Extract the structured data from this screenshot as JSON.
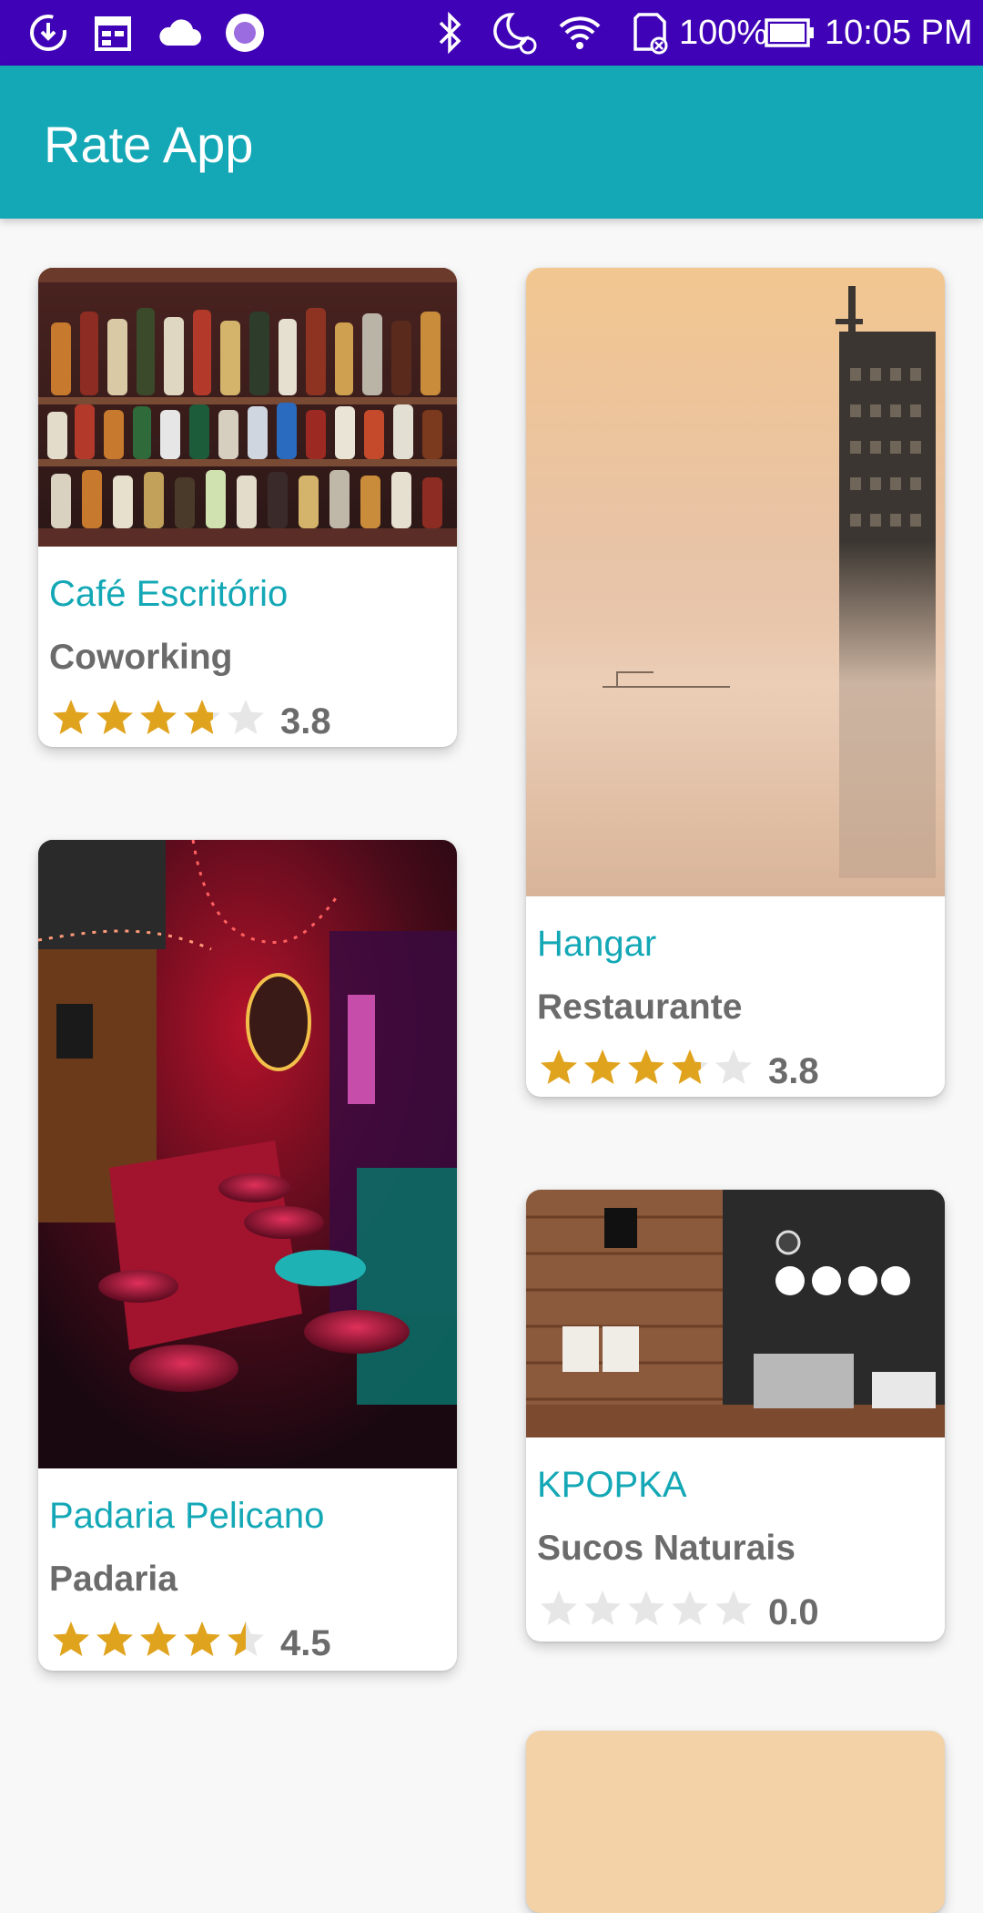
{
  "status_bar": {
    "battery": "100%",
    "time": "10:05 PM",
    "icons": [
      "download-icon",
      "calendar-icon",
      "cloud-icon",
      "circle-app-icon",
      "bluetooth-icon",
      "do-not-disturb-moon-icon",
      "wifi-icon",
      "sd-card-icon",
      "battery-icon"
    ]
  },
  "app_bar": {
    "title": "Rate App"
  },
  "colors": {
    "status_bar": "#3f02b6",
    "app_bar": "#14a8b6",
    "title": "#14a8b6",
    "star_on": "#e0a31e",
    "star_off": "#e6e6e6"
  },
  "cards": [
    {
      "name": "Café Escritório",
      "category": "Coworking",
      "rating_text": "3.8",
      "rating": 3.8,
      "image": "bar-shelf-bottles-photo"
    },
    {
      "name": "Hangar",
      "category": "Restaurante",
      "rating_text": "3.8",
      "rating": 3.8,
      "image": "foggy-skyscraper-photo"
    },
    {
      "name": "Padaria Pelicano",
      "category": "Padaria",
      "rating_text": "4.5",
      "rating": 4.5,
      "image": "neon-bar-stools-photo"
    },
    {
      "name": "KPOPKA",
      "category": "Sucos Naturais",
      "rating_text": "0.0",
      "rating": 0.0,
      "image": "cafe-counter-wood-wall-photo"
    }
  ]
}
